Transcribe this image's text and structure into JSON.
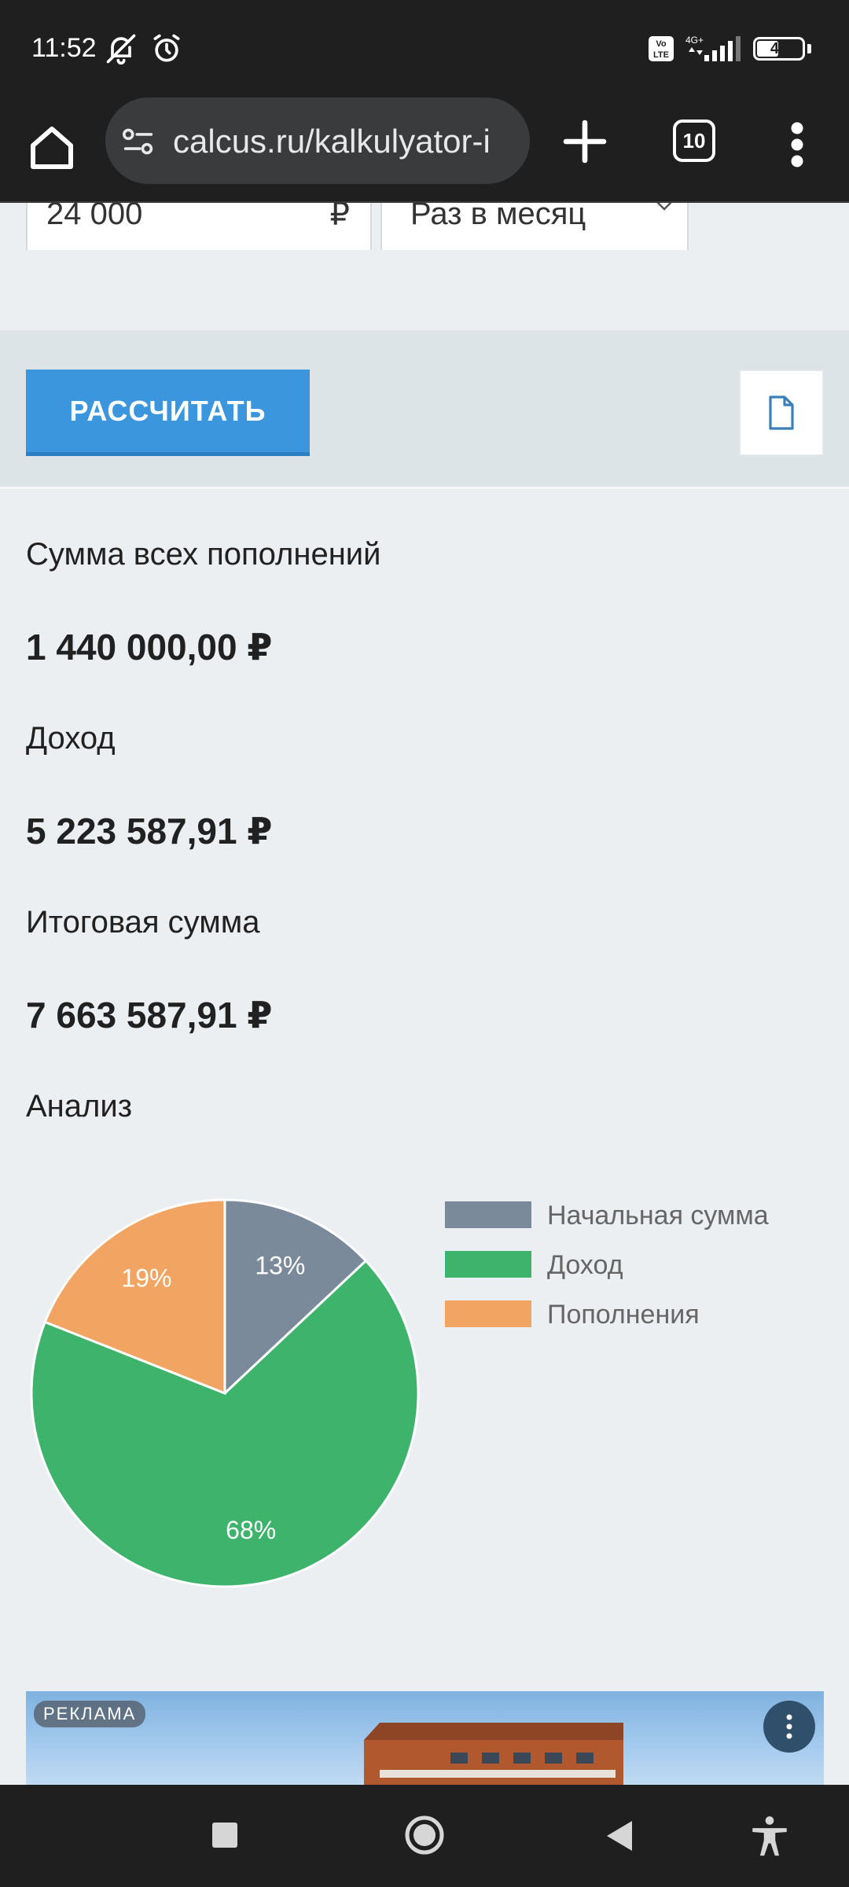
{
  "status_bar": {
    "time": "11:52",
    "battery": "46",
    "battery_level": 0.46,
    "network": "4G+",
    "volte": "Vo LTE"
  },
  "browser": {
    "url": "calcus.ru/kalkulyator-i",
    "tab_count": "10"
  },
  "form": {
    "amount_value": "24 000",
    "amount_currency": "₽",
    "frequency_value": "Раз в месяц"
  },
  "actions": {
    "calculate_label": "РАССЧИТАТЬ"
  },
  "results": {
    "deposits_label": "Сумма всех пополнений",
    "deposits_value": "1 440 000,00 ₽",
    "income_label": "Доход",
    "income_value": "5 223 587,91 ₽",
    "total_label": "Итоговая сумма",
    "total_value": "7 663 587,91 ₽",
    "analysis_label": "Анализ"
  },
  "chart_data": {
    "type": "pie",
    "title": "",
    "categories": [
      "Начальная сумма",
      "Доход",
      "Пополнения"
    ],
    "values": [
      13,
      68,
      19
    ],
    "labels": [
      "13%",
      "68%",
      "19%"
    ],
    "colors": [
      "#7b8a9a",
      "#3db36b",
      "#f2a463"
    ],
    "legend_position": "right"
  },
  "ad": {
    "label": "РЕКЛАМА"
  }
}
